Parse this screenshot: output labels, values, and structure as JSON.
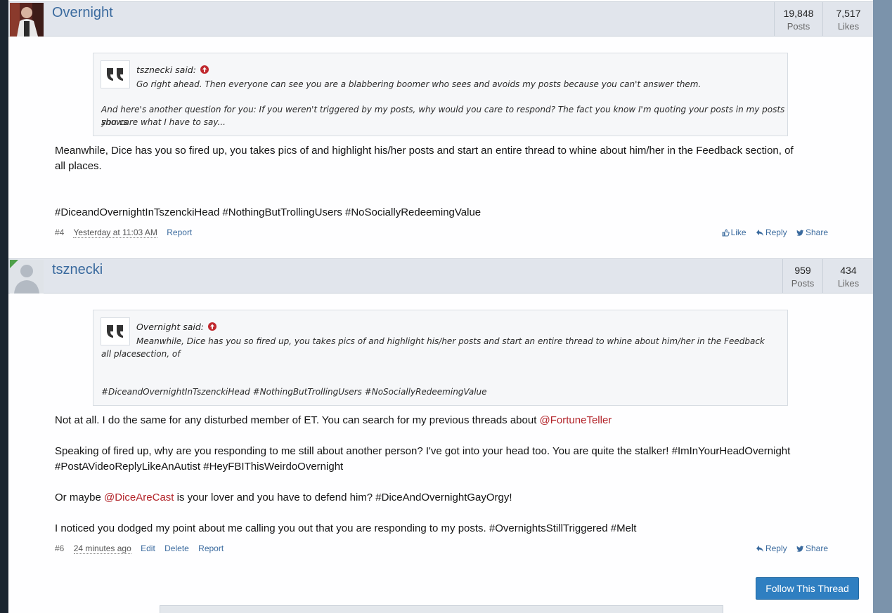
{
  "posts": [
    {
      "username": "Overnight",
      "stats": {
        "posts_count": "19,848",
        "posts_label": "Posts",
        "likes_count": "7,517",
        "likes_label": "Likes"
      },
      "quote": {
        "author": "tsznecki said:",
        "lines": [
          "Go right ahead. Then everyone can see you are a blabbering boomer who sees and avoids my posts because you can't answer them.",
          "And here's another question for you: If you weren't triggered by my posts, why would you care to respond? The fact you know I'm quoting your posts in my posts shows",
          "you care what I have to say..."
        ]
      },
      "body": {
        "line1": "Meanwhile, Dice has you so fired up, you takes pics of and highlight his/her posts and start an entire thread to whine about him/her in the Feedback section, of",
        "line2": "all places.",
        "hashtags": "#DiceandOvernightInTszenckiHead #NothingButTrollingUsers #NoSociallyRedeemingValue"
      },
      "footer": {
        "number": "#4",
        "timestamp": "Yesterday at 11:03 AM",
        "report": "Report",
        "like": "Like",
        "reply": "Reply",
        "share": "Share"
      }
    },
    {
      "username": "tsznecki",
      "stats": {
        "posts_count": "959",
        "posts_label": "Posts",
        "likes_count": "434",
        "likes_label": "Likes"
      },
      "quote": {
        "author": "Overnight said:",
        "lines": [
          "Meanwhile, Dice has you so fired up, you takes pics of and highlight his/her posts and start an entire thread to whine about him/her in the Feedback section, of",
          "all places.",
          "#DiceandOvernightInTszenckiHead #NothingButTrollingUsers #NoSociallyRedeemingValue"
        ]
      },
      "body": {
        "p1_text": "Not at all. I do the same for any disturbed member of ET. You can search for my previous threads about ",
        "p1_mention": "@FortuneTeller",
        "p2_line1": "Speaking of fired up, why are you responding to me still about another person? I've got into your head too. You are quite the stalker! #ImInYourHeadOvernight",
        "p2_line2": "#PostAVideoReplyLikeAnAutist #HeyFBIThisWeirdoOvernight",
        "p3_before": "Or maybe ",
        "p3_mention": "@DiceAreCast",
        "p3_after": " is your lover and you have to defend him? #DiceAndOvernightGayOrgy!",
        "p4": "I noticed you dodged my point about me calling you out that you are responding to my posts. #OvernightsStillTriggered #Melt"
      },
      "footer": {
        "number": "#6",
        "timestamp": "24 minutes ago",
        "edit": "Edit",
        "delete": "Delete",
        "report": "Report",
        "reply": "Reply",
        "share": "Share"
      }
    }
  ],
  "follow_button": "Follow This Thread",
  "colors": {
    "accent": "#2f7fc1",
    "mention": "#b2242a",
    "link": "#3a6a9e",
    "header_bg": "#e1e5ec"
  }
}
